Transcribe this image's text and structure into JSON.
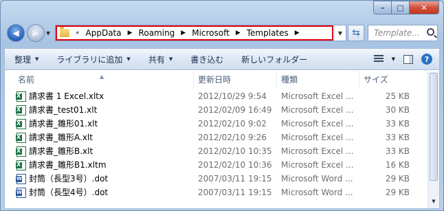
{
  "window": {
    "caption_buttons": {
      "minimize": "–",
      "maximize": "□",
      "close": "✕"
    },
    "nav": {
      "back_icon": "back-arrow-icon",
      "forward_icon": "forward-arrow-icon",
      "breadcrumb_prefix": "«",
      "breadcrumb": [
        "AppData",
        "Roaming",
        "Microsoft",
        "Templates"
      ],
      "search_placeholder": "Template..."
    },
    "toolbar": {
      "organize": "整理",
      "add_to_library": "ライブラリに追加",
      "share": "共有",
      "burn": "書き込む",
      "new_folder": "新しいフォルダー",
      "help": "?"
    },
    "columns": {
      "name": "名前",
      "modified": "更新日時",
      "type": "種類",
      "size": "サイズ"
    },
    "files": [
      {
        "icon": "excel-icon",
        "name": "請求書 1 Excel.xltx",
        "modified": "2012/10/29 9:54",
        "type": "Microsoft Excel ...",
        "size": "25 KB"
      },
      {
        "icon": "excel-icon",
        "name": "請求書_test01.xlt",
        "modified": "2012/02/09 16:49",
        "type": "Microsoft Excel ...",
        "size": "30 KB"
      },
      {
        "icon": "excel-icon",
        "name": "請求書_雛形01.xlt",
        "modified": "2012/02/10 9:02",
        "type": "Microsoft Excel ...",
        "size": "33 KB"
      },
      {
        "icon": "excel-icon",
        "name": "請求書_雛形A.xlt",
        "modified": "2012/02/10 9:26",
        "type": "Microsoft Excel ...",
        "size": "33 KB"
      },
      {
        "icon": "excel-icon",
        "name": "請求書_雛形B.xlt",
        "modified": "2012/02/10 10:35",
        "type": "Microsoft Excel ...",
        "size": "33 KB"
      },
      {
        "icon": "excel-icon",
        "name": "請求書_雛形B1.xltm",
        "modified": "2012/02/10 10:36",
        "type": "Microsoft Excel ...",
        "size": "16 KB"
      },
      {
        "icon": "word-icon",
        "name": "封筒（長型3号）.dot",
        "modified": "2007/03/11 19:15",
        "type": "Microsoft Word ...",
        "size": "29 KB"
      },
      {
        "icon": "word-icon",
        "name": "封筒（長型4号）.dot",
        "modified": "2007/03/11 19:15",
        "type": "Microsoft Word ...",
        "size": "29 KB"
      }
    ]
  }
}
